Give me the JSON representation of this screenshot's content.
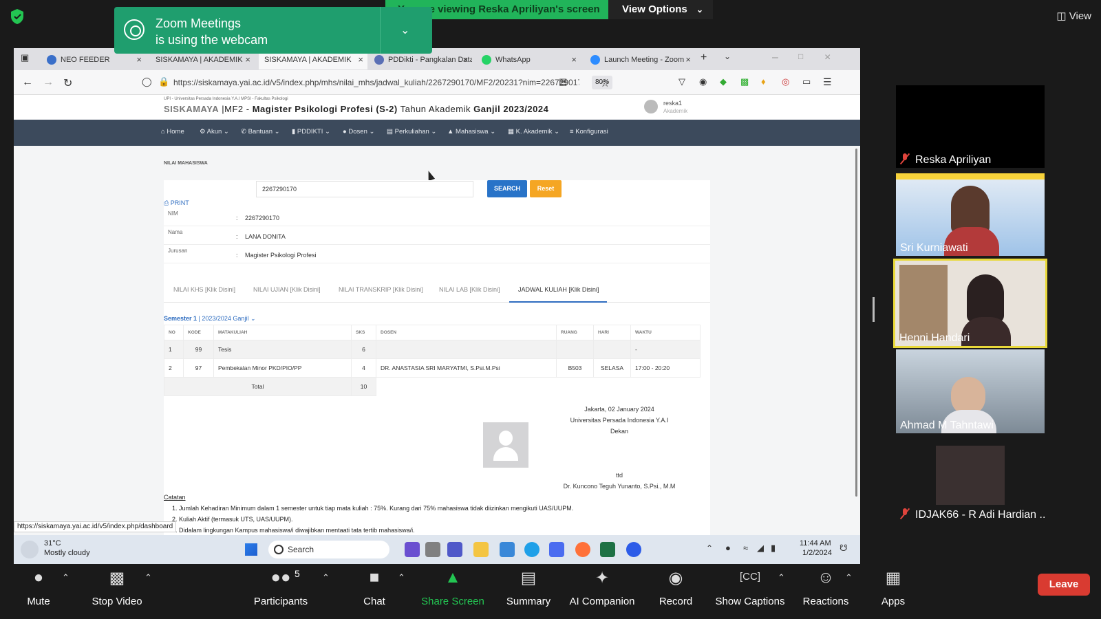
{
  "zoom": {
    "share_banner": "You are viewing Reska Apriliyan's screen",
    "view_options": "View Options",
    "view_label": "View",
    "toast_line1": "Zoom Meetings",
    "toast_line2": "is using the webcam",
    "controls": {
      "mute": "Mute",
      "stop_video": "Stop Video",
      "participants": "Participants",
      "participants_count": "5",
      "chat": "Chat",
      "share_screen": "Share Screen",
      "summary": "Summary",
      "ai_companion": "AI Companion",
      "record": "Record",
      "show_captions": "Show Captions",
      "reactions": "Reactions",
      "apps": "Apps",
      "leave": "Leave"
    },
    "participants": [
      {
        "name": "Reska Apriliyan",
        "muted": true
      },
      {
        "name": "Sri Kurniawati",
        "muted": false
      },
      {
        "name": "Henni Handari",
        "muted": false,
        "active_speaker": true
      },
      {
        "name": "Ahmad M Tahntawi",
        "muted": false
      },
      {
        "name": "IDJAK66 - R Adi Hardian ...",
        "muted": true
      }
    ],
    "colors": {
      "banner_green": "#21b45a",
      "leave_red": "#d93b31",
      "active_speaker": "#e8d83a"
    }
  },
  "browser": {
    "tabs": [
      {
        "label": "NEO FEEDER",
        "active": false
      },
      {
        "label": "SISKAMAYA | AKADEMIK",
        "active": false
      },
      {
        "label": "SISKAMAYA | AKADEMIK",
        "active": true
      },
      {
        "label": "PDDikti - Pangkalan Data",
        "active": false
      },
      {
        "label": "WhatsApp",
        "active": false
      },
      {
        "label": "Launch Meeting - Zoom",
        "active": false
      }
    ],
    "url": "https://siskamaya.yai.ac.id/v5/index.php/mhs/nilai_mhs/jadwal_kuliah/2267290170/MF2/20231?nim=2267290170",
    "zoom_level": "80%",
    "status_url": "https://siskamaya.yai.ac.id/v5/index.php/dashboard"
  },
  "site": {
    "small_header": "UPI - Universitas Persada Indonesia Y.A.I MPSI - Fakultas Psikologi",
    "brand": "SISKAMAYA",
    "program_code": "MF2 - ",
    "program_name": "Magister Psikologi Profesi (S-2)",
    "year_prefix": " Tahun Akademik ",
    "year": "Ganjil 2023/2024",
    "user_name": "reska1",
    "user_role": "Akademik",
    "nav": [
      "Home",
      "Akun",
      "Bantuan",
      "PDDIKTI",
      "Dosen",
      "Perkuliahan",
      "Mahasiswa",
      "K. Akademik",
      "Konfigurasi"
    ],
    "page_label": "NILAI MAHASISWA",
    "search_value": "2267290170",
    "search_btn": "SEARCH",
    "reset_btn": "Reset",
    "print": "PRINT",
    "info": [
      {
        "label": "NIM",
        "value": "2267290170"
      },
      {
        "label": "Nama",
        "value": "LANA DONITA"
      },
      {
        "label": "Jurusan",
        "value": "Magister Psikologi Profesi"
      }
    ],
    "tabs": [
      "NILAI KHS [Klik Disini]",
      "NILAI UJIAN [Klik Disini]",
      "NILAI TRANSKRIP [Klik Disini]",
      "NILAI LAB [Klik Disini]",
      "JADWAL KULIAH [Klik Disini]"
    ],
    "semester_prefix": "Semester 1",
    "semester_rest": " | 2023/2024 Ganjil",
    "table": {
      "headers": [
        "NO",
        "KODE",
        "MATAKULIAH",
        "SKS",
        "DOSEN",
        "RUANG",
        "HARI",
        "WAKTU"
      ],
      "rows": [
        [
          "1",
          "99",
          "Tesis",
          "6",
          "",
          "",
          "",
          "-"
        ],
        [
          "2",
          "97",
          "Pembekalan Minor PKD/PIO/PP",
          "4",
          "DR. ANASTASIA SRI MARYATMI, S.Psi.M.Psi",
          "B503",
          "SELASA",
          "17:00 - 20:20"
        ]
      ],
      "total_label": "Total",
      "total_value": "10"
    },
    "sign": {
      "date": "Jakarta, 02 January 2024",
      "univ": "Universitas Persada Indonesia Y.A.I",
      "title": "Dekan",
      "ttd": "ttd",
      "name": "Dr. Kuncono Teguh Yunanto, S.Psi., M.M"
    },
    "catatan": "Catatan",
    "notes": [
      "1. Jumlah Kehadiran Minimum dalam 1 semester untuk tiap mata kuliah : 75%. Kurang dari 75% mahasiswa tidak diizinkan mengikuti UAS/UUPM.",
      "2. Kuliah Aktif (termasuk UTS, UAS/UUPM).",
      "3. Didalam lingkungan Kampus mahasiswa/i diwajibkan mentaati tata tertib mahasiswa/i."
    ]
  },
  "taskbar": {
    "weather_temp": "31°C",
    "weather_desc": "Mostly cloudy",
    "search": "Search",
    "time": "11:44 AM",
    "date": "1/2/2024"
  }
}
